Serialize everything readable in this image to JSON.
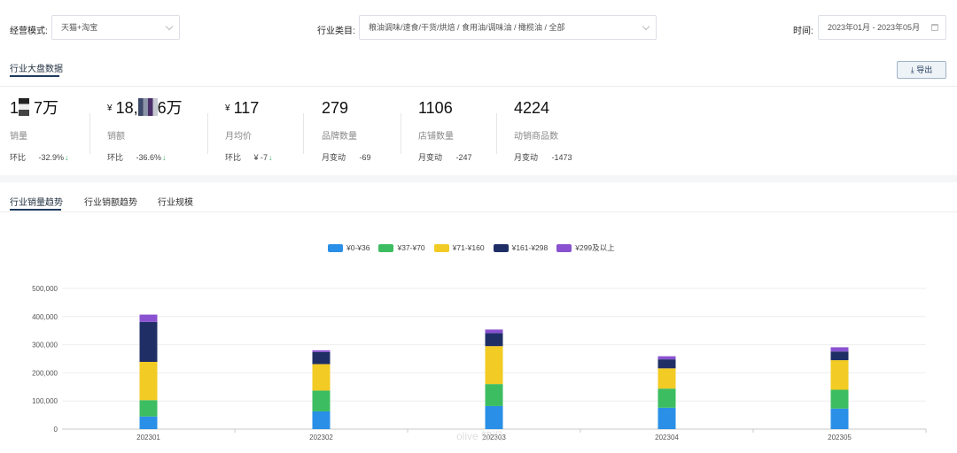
{
  "filters": {
    "mode_label": "经营模式:",
    "mode_value": "天猫+淘宝",
    "category_label": "行业类目:",
    "category_value": "粮油调味/速食/干货/烘焙 / 食用油/调味油 / 橄榄油 / 全部",
    "time_label": "时间:",
    "time_value": "2023年01月 - 2023年05月"
  },
  "section": {
    "title": "行业大盘数据",
    "export_label": "导出"
  },
  "metrics": [
    {
      "value_a": "1",
      "value_b": "7万",
      "name": "销量",
      "sub_label": "环比",
      "sub_value": "-32.9%",
      "arrow": "↓"
    },
    {
      "currency": "¥",
      "value_a": "18,",
      "value_b": "6万",
      "name": "销额",
      "sub_label": "环比",
      "sub_value": "-36.6%",
      "arrow": "↓"
    },
    {
      "currency": "¥",
      "value": "117",
      "name": "月均价",
      "sub_label": "环比",
      "sub_value": "¥ -7",
      "arrow": "↓"
    },
    {
      "value": "279",
      "name": "品牌数量",
      "sub_label": "月变动",
      "sub_value": "-69"
    },
    {
      "value": "1106",
      "name": "店铺数量",
      "sub_label": "月变动",
      "sub_value": "-247"
    },
    {
      "value": "4224",
      "name": "动销商品数",
      "sub_label": "月变动",
      "sub_value": "-1473"
    }
  ],
  "tabs": [
    "行业销量趋势",
    "行业销额趋势",
    "行业规模"
  ],
  "watermark": "olive 知识",
  "colors": [
    "#2a8fe6",
    "#3dbd61",
    "#f2cb24",
    "#1f2f66",
    "#8a52d1"
  ],
  "chart_data": {
    "type": "bar",
    "stacked": true,
    "categories": [
      "202301",
      "202302",
      "202303",
      "202304",
      "202305"
    ],
    "series": [
      {
        "name": "¥0-¥36",
        "values": [
          45000,
          63000,
          82000,
          76000,
          73000
        ]
      },
      {
        "name": "¥37-¥70",
        "values": [
          58000,
          74000,
          78000,
          68000,
          67000
        ]
      },
      {
        "name": "¥71-¥160",
        "values": [
          136000,
          94000,
          135000,
          72000,
          105000
        ]
      },
      {
        "name": "¥161-¥298",
        "values": [
          142000,
          43000,
          46000,
          32000,
          31000
        ]
      },
      {
        "name": "¥299及以上",
        "values": [
          26000,
          6000,
          13000,
          11000,
          15000
        ]
      }
    ],
    "ylim": [
      0,
      500000
    ],
    "yticks": [
      "0",
      "100,000",
      "200,000",
      "300,000",
      "400,000",
      "500,000"
    ],
    "grid": true,
    "legend": "top"
  }
}
